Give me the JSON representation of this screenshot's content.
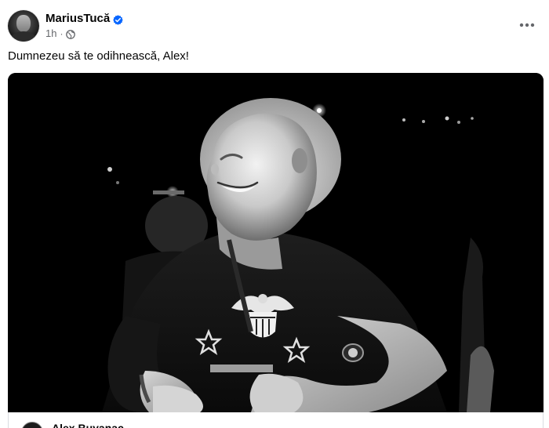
{
  "post": {
    "author_name": "MariusTucă",
    "timestamp": "1h",
    "audience_icon": "globe-icon",
    "verified_icon": "verified-badge-icon",
    "more_icon": "more-options-icon",
    "text": "Dumnezeu să te odihnească, Alex!"
  },
  "media": {
    "kind": "black-and-white photo"
  },
  "link_card": {
    "name": "Alex Buyanac"
  },
  "colors": {
    "text_primary": "#050505",
    "text_secondary": "#65676b",
    "verified_blue": "#0866ff",
    "background": "#ffffff"
  }
}
